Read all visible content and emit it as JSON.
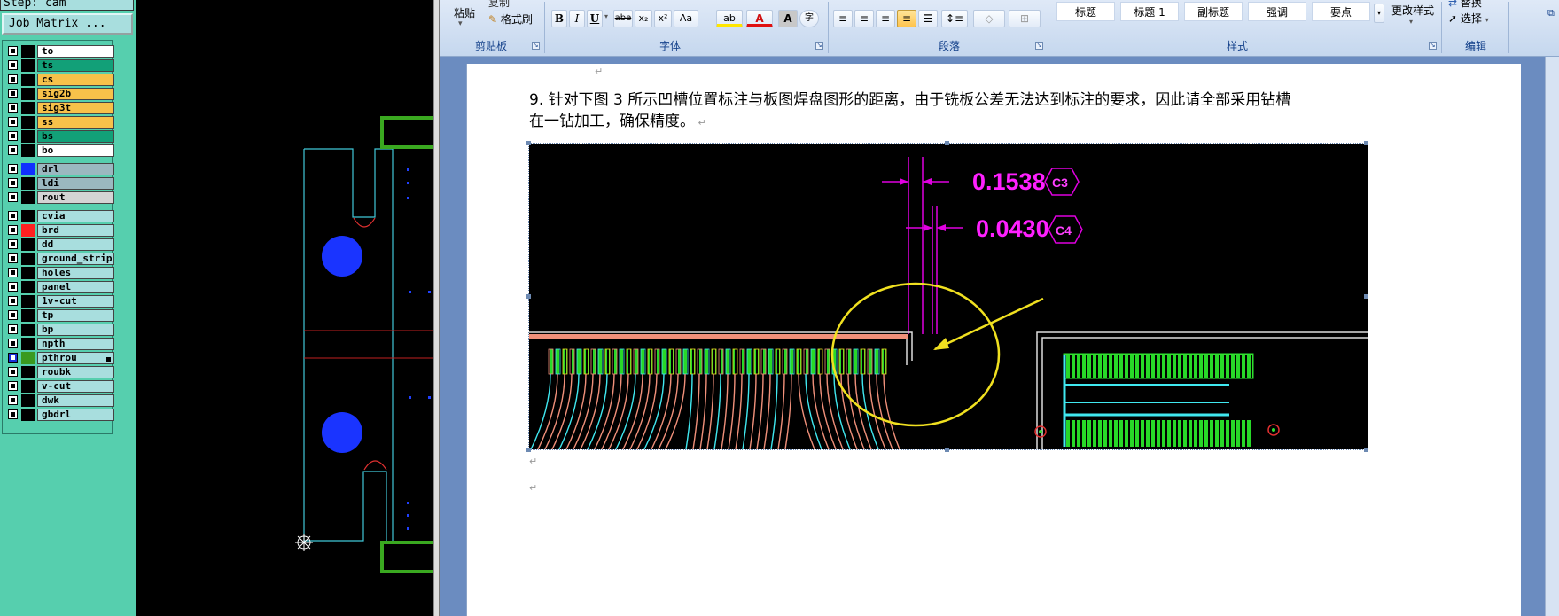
{
  "cam": {
    "step_label": "Step: cam",
    "job_matrix_button": "Job Matrix ...",
    "layers": [
      {
        "name": "to",
        "color": "#ffffff",
        "swatch": "#000000"
      },
      {
        "name": "ts",
        "color": "#12a078",
        "swatch": "#000000"
      },
      {
        "name": "cs",
        "color": "#f7c14a",
        "swatch": "#000000"
      },
      {
        "name": "sig2b",
        "color": "#f7c14a",
        "swatch": "#000000"
      },
      {
        "name": "sig3t",
        "color": "#f7c14a",
        "swatch": "#000000"
      },
      {
        "name": "ss",
        "color": "#f7c14a",
        "swatch": "#000000"
      },
      {
        "name": "bs",
        "color": "#12a078",
        "swatch": "#000000"
      },
      {
        "name": "bo",
        "color": "#ffffff",
        "swatch": "#000000"
      },
      {
        "name": "drl",
        "color": "#9bb8c0",
        "swatch": "#1030ff"
      },
      {
        "name": "ldi",
        "color": "#9bb8c0",
        "swatch": "#000000"
      },
      {
        "name": "rout",
        "color": "#d4d4d4",
        "swatch": "#000000"
      },
      {
        "name": "cvia",
        "color": "#a8dede",
        "swatch": "#000000"
      },
      {
        "name": "brd",
        "color": "#a8dede",
        "swatch": "#ff2020"
      },
      {
        "name": "dd",
        "color": "#a8dede",
        "swatch": "#000000"
      },
      {
        "name": "ground_strip",
        "color": "#a8dede",
        "swatch": "#000000"
      },
      {
        "name": "holes",
        "color": "#a8dede",
        "swatch": "#000000"
      },
      {
        "name": "panel",
        "color": "#a8dede",
        "swatch": "#000000"
      },
      {
        "name": "1v-cut",
        "color": "#a8dede",
        "swatch": "#000000"
      },
      {
        "name": "tp",
        "color": "#a8dede",
        "swatch": "#000000"
      },
      {
        "name": "bp",
        "color": "#a8dede",
        "swatch": "#000000"
      },
      {
        "name": "npth",
        "color": "#a8dede",
        "swatch": "#000000"
      },
      {
        "name": "pthrou",
        "color": "#a8dede",
        "swatch": "#3a9a20",
        "checked": true
      },
      {
        "name": "roubk",
        "color": "#a8dede",
        "swatch": "#000000"
      },
      {
        "name": "v-cut",
        "color": "#a8dede",
        "swatch": "#000000"
      },
      {
        "name": "dwk",
        "color": "#a8dede",
        "swatch": "#000000"
      },
      {
        "name": "gbdrl",
        "color": "#a8dede",
        "swatch": "#000000"
      }
    ]
  },
  "ribbon": {
    "clipboard": {
      "paste_label": "粘贴",
      "copy_label": "复制",
      "format_painter_label": "格式刷",
      "group_label": "剪贴板"
    },
    "font": {
      "bold": "B",
      "italic": "I",
      "underline": "U",
      "strike": "abe",
      "subscript": "x₂",
      "superscript": "x²",
      "change_case": "Aa",
      "highlight": "ab",
      "font_color": "A",
      "char_shading": "A",
      "enclose": "字",
      "group_label": "字体"
    },
    "paragraph": {
      "group_label": "段落"
    },
    "styles": {
      "items": [
        "标题",
        "标题 1",
        "副标题",
        "强调",
        "要点"
      ],
      "change_styles_label": "更改样式",
      "group_label": "样式"
    },
    "editing": {
      "select_label": "选择",
      "replace_label": "替换",
      "group_label": "编辑"
    }
  },
  "document": {
    "line1": "9. 针对下图 3 所示凹槽位置标注与板图焊盘图形的距离，由于铣板公差无法达到标注的要求，因此请全部采用钻槽",
    "line2": "在一钻加工，确保精度。",
    "figure": {
      "dim1": "0.1538",
      "dim1_tag": "C3",
      "dim2": "0.0430",
      "dim2_tag": "C4"
    }
  }
}
